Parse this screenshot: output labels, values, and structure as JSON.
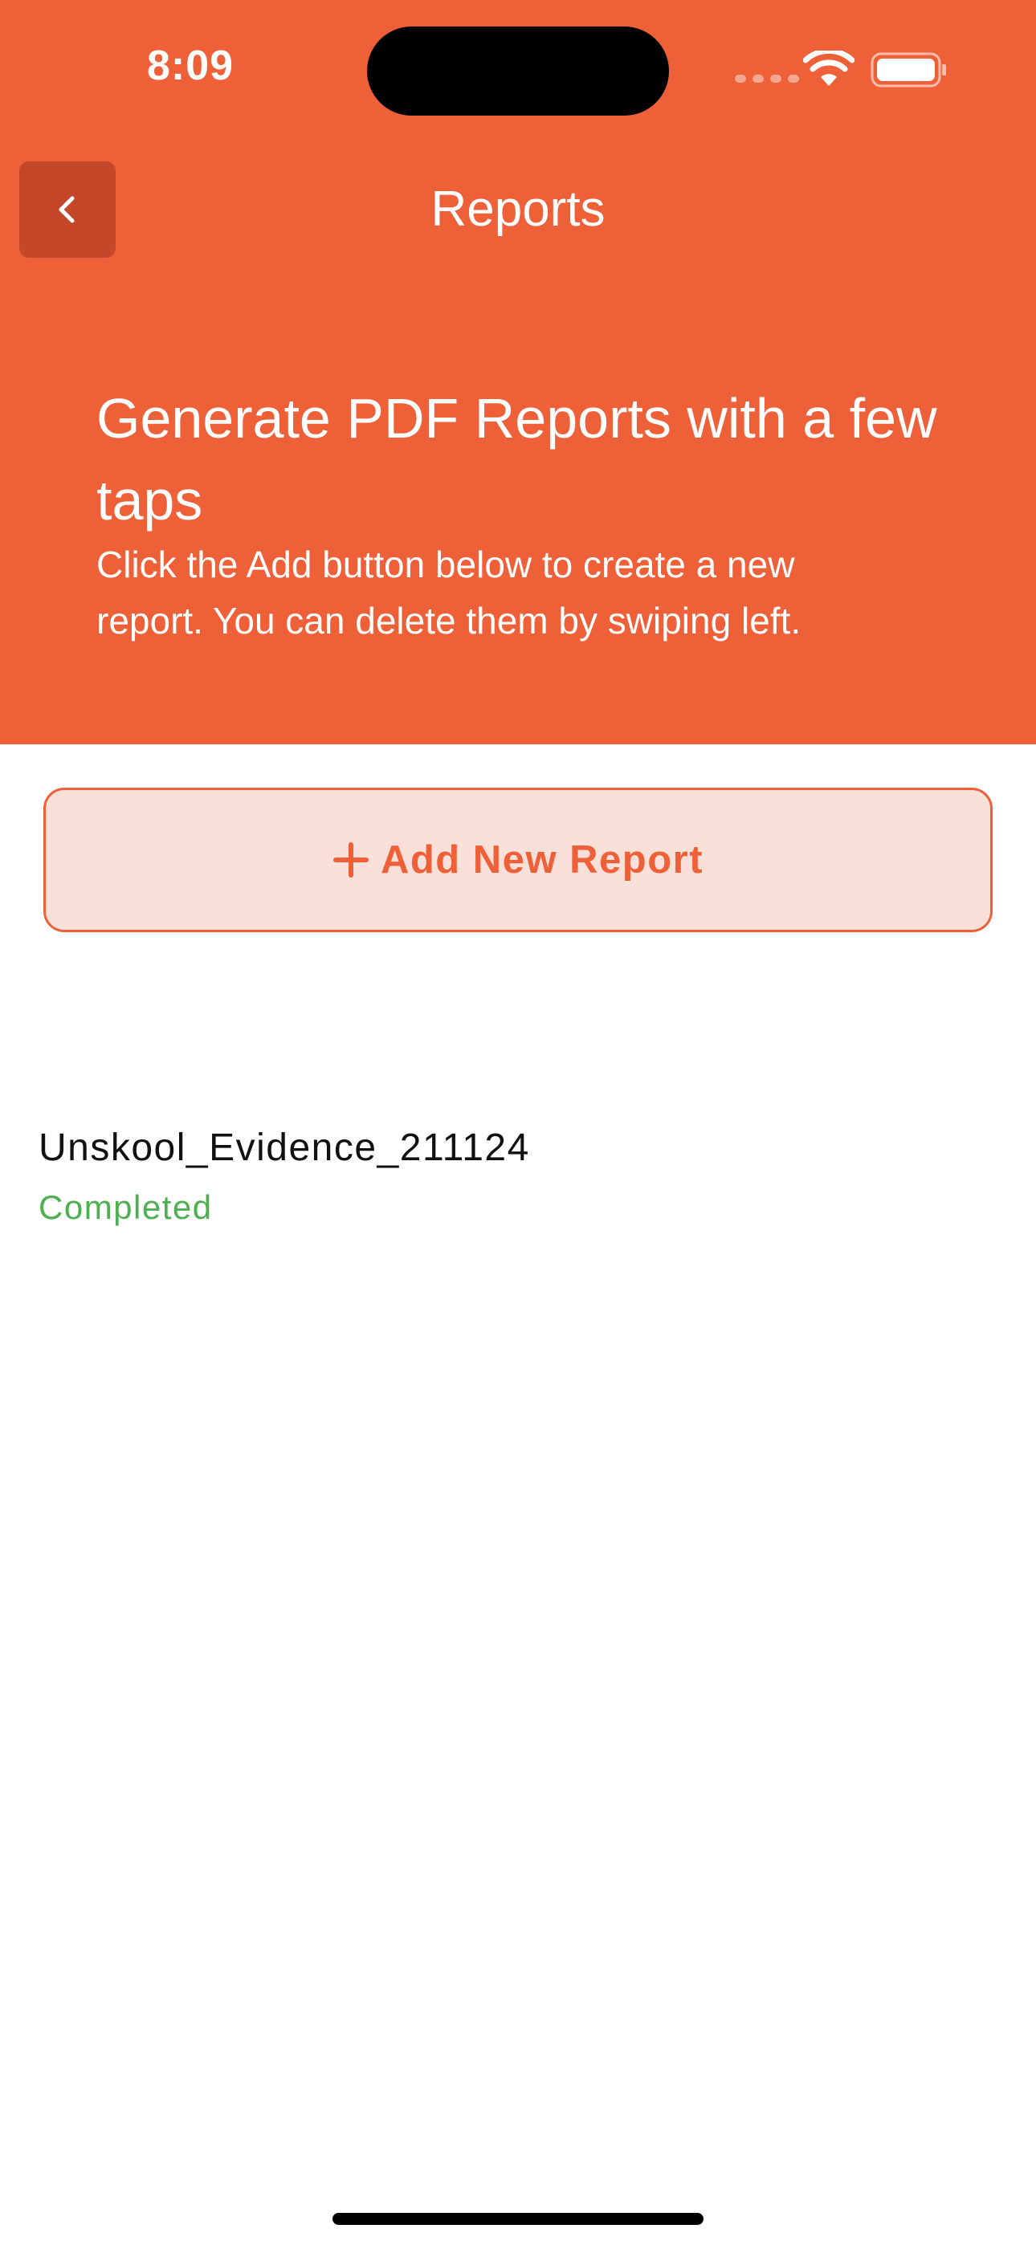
{
  "status_bar": {
    "time": "8:09"
  },
  "nav": {
    "title": "Reports",
    "back_icon": "chevron-left-icon"
  },
  "hero": {
    "title": "Generate PDF Reports with a few taps",
    "subtitle": "Click the Add button below to create a new report. You can delete them by swiping left."
  },
  "add_button": {
    "label": "Add New Report",
    "icon": "plus-icon"
  },
  "reports": [
    {
      "name": "Unskool_Evidence_211124",
      "status": "Completed",
      "status_color": "#4CAF50"
    }
  ],
  "colors": {
    "accent": "#EE6038",
    "back_button_bg": "#C4472A",
    "add_button_bg": "#FBDFD9"
  }
}
